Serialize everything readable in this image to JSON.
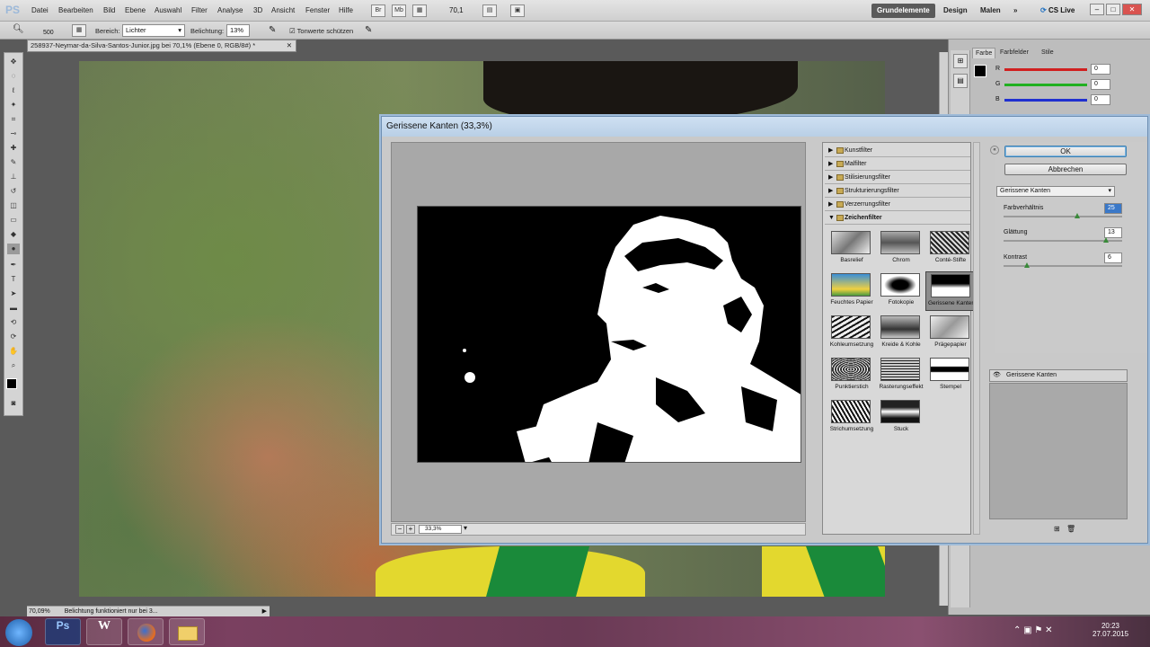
{
  "app": {
    "logo": "PS"
  },
  "menu": [
    "Datei",
    "Bearbeiten",
    "Bild",
    "Ebene",
    "Auswahl",
    "Filter",
    "Analyse",
    "3D",
    "Ansicht",
    "Fenster",
    "Hilfe"
  ],
  "top_toolbar": {
    "zoom": "70,1"
  },
  "workspaces": {
    "active": "Grundelemente",
    "others": [
      "Design",
      "Malen"
    ],
    "more": "»",
    "cslive": "CS Live"
  },
  "options": {
    "brush_size": "500",
    "range_label": "Bereich:",
    "range_value": "Lichter",
    "exposure_label": "Belichtung:",
    "exposure_value": "13%",
    "protect_tones": "Tonwerte schützen"
  },
  "document": {
    "tab_title": "258937-Neymar-da-Silva-Santos-Junior.jpg bei 70,1% (Ebene 0, RGB/8#) *"
  },
  "status": {
    "zoom": "70,09%",
    "message": "Belichtung funktioniert nur bei 3..."
  },
  "color_panel": {
    "tabs": [
      "Farbe",
      "Farbfelder",
      "Stile"
    ],
    "channels": [
      {
        "name": "R",
        "value": "0",
        "color": "#d02020"
      },
      {
        "name": "G",
        "value": "0",
        "color": "#20b020"
      },
      {
        "name": "B",
        "value": "0",
        "color": "#2030d0"
      }
    ]
  },
  "dialog": {
    "title": "Gerissene Kanten (33,3%)",
    "zoom": "33,3%",
    "categories": [
      "Kunstfilter",
      "Malfilter",
      "Stilisierungsfilter",
      "Strukturierungsfilter",
      "Verzerrungsfilter"
    ],
    "open_category": "Zeichenfilter",
    "filters": [
      "Basrelief",
      "Chrom",
      "Conté-Stifte",
      "Feuchtes Papier",
      "Fotokopie",
      "Gerissene Kanten",
      "Kohleumsetzung",
      "Kreide & Kohle",
      "Prägepapier",
      "Punktierstich",
      "Rasterungseffekt",
      "Stempel",
      "Strichumsetzung",
      "Stuck"
    ],
    "selected_filter": "Gerissene Kanten",
    "ok": "OK",
    "cancel": "Abbrechen",
    "filter_dropdown": "Gerissene Kanten",
    "params": [
      {
        "label": "Farbverhältnis",
        "value": "25",
        "level": 0.62
      },
      {
        "label": "Glättung",
        "value": "13",
        "level": 0.86
      },
      {
        "label": "Kontrast",
        "value": "6",
        "level": 0.2
      }
    ],
    "layer_item": "Gerissene Kanten"
  },
  "taskbar": {
    "time": "20:23",
    "date": "27.07.2015",
    "apps": [
      "Ps",
      "W",
      "Firefox",
      "Explorer"
    ]
  }
}
